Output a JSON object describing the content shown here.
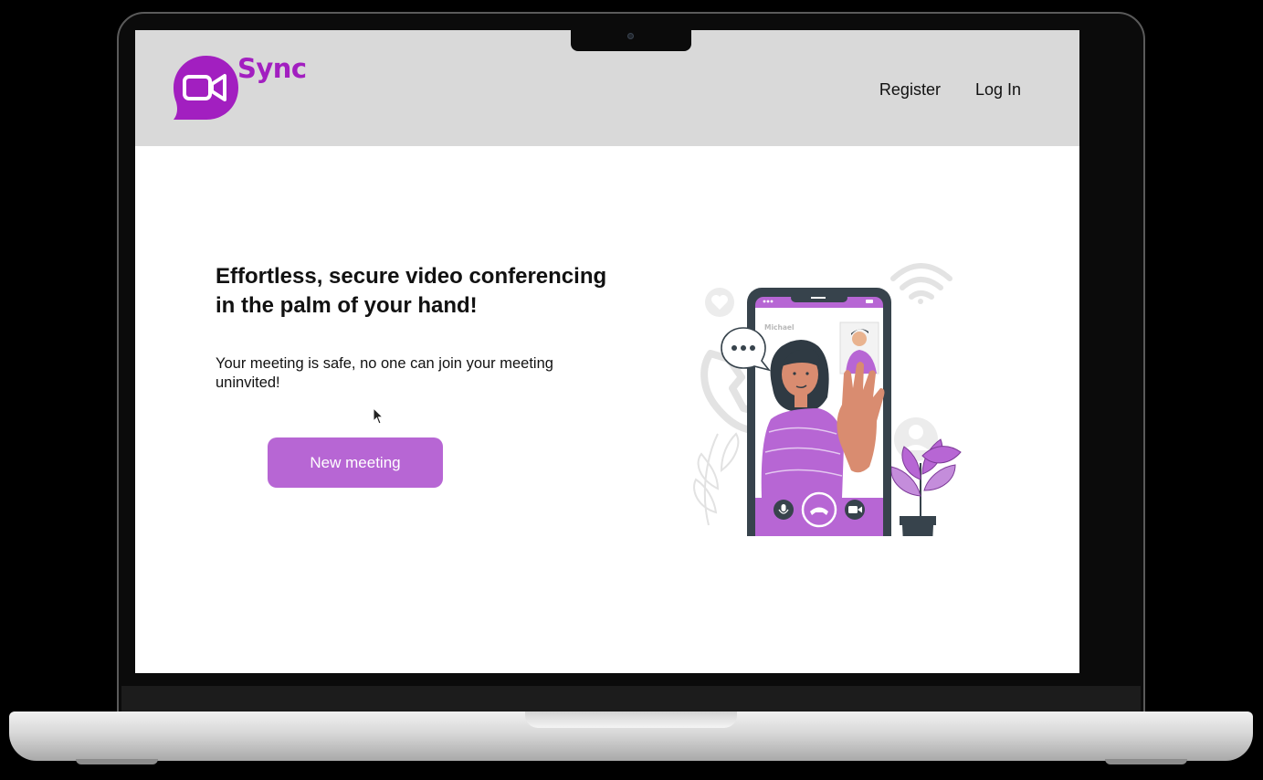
{
  "header": {
    "brand": "Sync",
    "nav": {
      "register": "Register",
      "login": "Log In"
    }
  },
  "hero": {
    "title": "Effortless, secure video conferencing in the palm of your hand!",
    "subtitle": "Your meeting is safe, no one can join your meeting uninvited!",
    "cta_label": "New meeting"
  },
  "illustration": {
    "caller_name": "Michael",
    "icons": [
      "microphone-icon",
      "hang-up-icon",
      "video-camera-icon",
      "wifi-icon",
      "chat-bubble-icon",
      "heart-icon",
      "phone-icon"
    ]
  },
  "colors": {
    "brand": "#a21fc0",
    "accent": "#b766d4",
    "header_bg": "#d9d9d9"
  }
}
